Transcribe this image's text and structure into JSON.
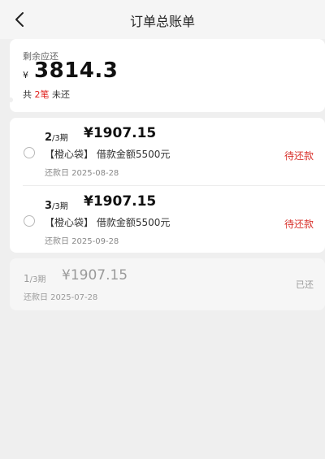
{
  "header": {
    "title": "订单总账单"
  },
  "summary": {
    "label": "剩余应还",
    "currency": "¥",
    "amount": "3814.3",
    "count_prefix": "共 ",
    "count_value": "2笔",
    "count_suffix": " 未还"
  },
  "pending_items": [
    {
      "period_current": "2",
      "period_total": "/3期",
      "amount": "¥1907.15",
      "description": "【橙心袋】 借款金额5500元",
      "date": "还款日 2025-08-28",
      "status": "待还款"
    },
    {
      "period_current": "3",
      "period_total": "/3期",
      "amount": "¥1907.15",
      "description": "【橙心袋】 借款金额5500元",
      "date": "还款日 2025-09-28",
      "status": "待还款"
    }
  ],
  "paid_item": {
    "period_current": "1",
    "period_total": "/3期",
    "amount": "¥1907.15",
    "date": "还款日 2025-07-28",
    "status": "已还"
  },
  "colors": {
    "accent_red": "#d8322c",
    "background": "#efefef"
  }
}
